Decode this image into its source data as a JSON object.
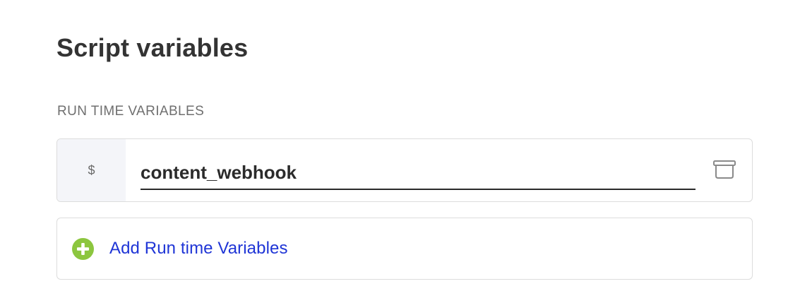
{
  "section": {
    "title": "Script variables",
    "subsection_label": "RUN TIME VARIABLES"
  },
  "variables": [
    {
      "prefix": "$",
      "name": "content_webhook",
      "delete_icon": "trash-icon"
    }
  ],
  "add_variable": {
    "label": "Add Run time Variables",
    "icon": "plus-circle-icon"
  },
  "colors": {
    "add_icon_green": "#8cc63f",
    "link_blue": "#1f35d6",
    "prefix_bg": "#f4f5f9"
  }
}
